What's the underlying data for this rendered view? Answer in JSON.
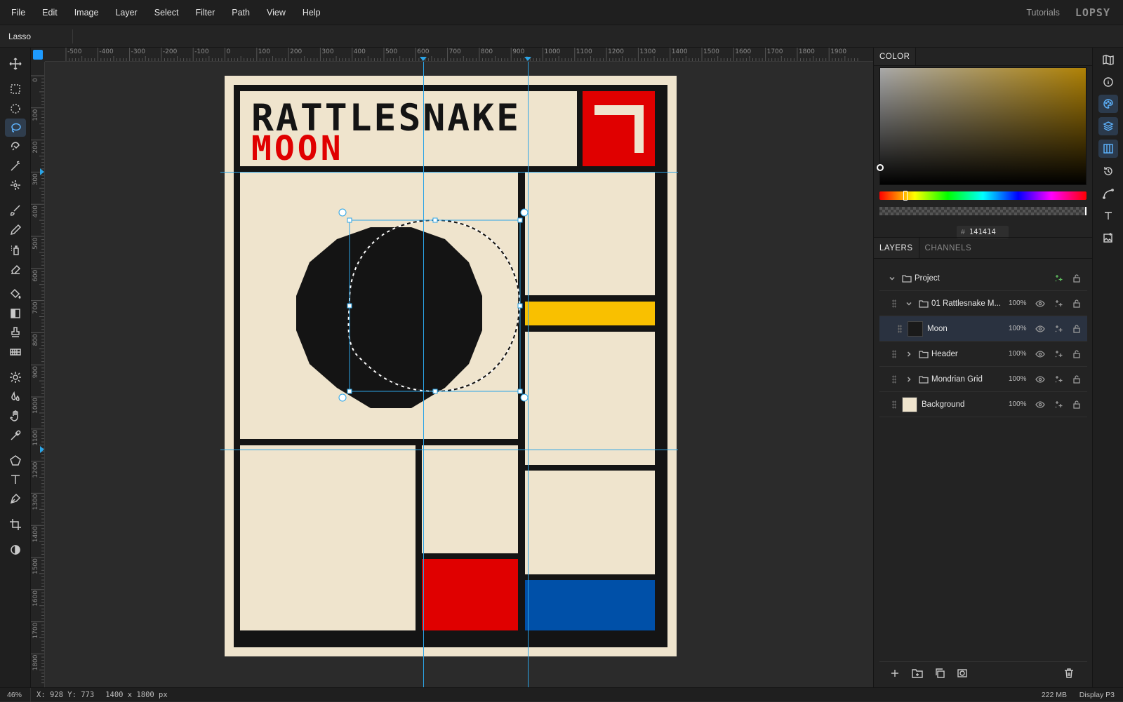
{
  "menu": {
    "items": [
      "File",
      "Edit",
      "Image",
      "Layer",
      "Select",
      "Filter",
      "Path",
      "View",
      "Help"
    ],
    "tutorials": "Tutorials",
    "logo": "LOPSY"
  },
  "options_bar": {
    "tool_name": "Lasso"
  },
  "rulers": {
    "horizontal_labels": [
      "-500",
      "-400",
      "-300",
      "-200",
      "-100",
      "0",
      "100",
      "200",
      "300",
      "400",
      "500",
      "600",
      "700",
      "800",
      "900",
      "1000",
      "1100",
      "1200",
      "1300",
      "1400",
      "1500",
      "1600",
      "1700",
      "1800",
      "1900"
    ],
    "vertical_labels": [
      "0",
      "100",
      "200",
      "300",
      "400",
      "500",
      "600",
      "700",
      "800",
      "900",
      "1000",
      "1100",
      "1200",
      "1300",
      "1400",
      "1500",
      "1600",
      "1700",
      "1800"
    ]
  },
  "artwork": {
    "title_line1": "RATTLESNAKE",
    "title_line2": "MOON",
    "colors": {
      "paper": "#efe4cd",
      "ink": "#141414",
      "red": "#e00000",
      "yellow": "#f9c000",
      "blue": "#0050a8"
    }
  },
  "color_panel": {
    "tab": "COLOR",
    "hex_value": "141414",
    "hex_prefix": "#"
  },
  "layers_panel": {
    "tabs": [
      "LAYERS",
      "CHANNELS"
    ],
    "layers": [
      {
        "name": "Project",
        "type": "group-root",
        "opacity": ""
      },
      {
        "name": "01 Rattlesnake M...",
        "type": "group",
        "opacity": "100%"
      },
      {
        "name": "Moon",
        "type": "layer",
        "opacity": "100%",
        "selected": true
      },
      {
        "name": "Header",
        "type": "group",
        "opacity": "100%"
      },
      {
        "name": "Mondrian Grid",
        "type": "group",
        "opacity": "100%"
      },
      {
        "name": "Background",
        "type": "layer",
        "opacity": "100%"
      }
    ]
  },
  "status_bar": {
    "zoom": "46%",
    "cursor": "X: 928 Y: 773",
    "doc_size": "1400 x 1800 px",
    "memory": "222 MB",
    "color_profile": "Display P3"
  }
}
